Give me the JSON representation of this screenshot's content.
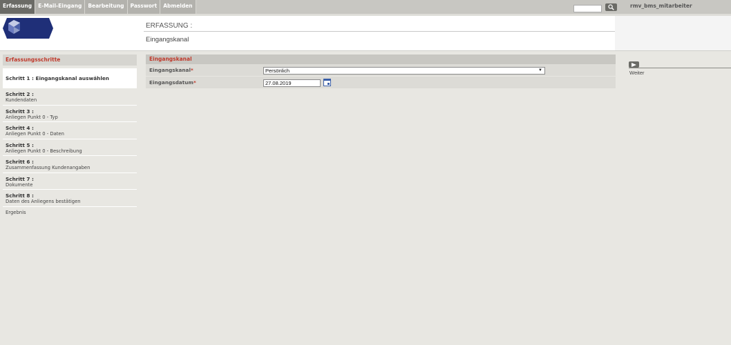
{
  "nav": {
    "tabs": [
      {
        "label": "Erfassung",
        "active": true
      },
      {
        "label": "E-Mail-Eingang",
        "active": false
      },
      {
        "label": "Bearbeitung",
        "active": false
      },
      {
        "label": "Passwort",
        "active": false
      },
      {
        "label": "Abmelden",
        "active": false
      }
    ],
    "search_value": "",
    "user": "rmv_bms_mitarbeiter"
  },
  "header": {
    "title": "ERFASSUNG :",
    "subtitle": "Eingangskanal"
  },
  "sidebar": {
    "heading": "Erfassungsschritte",
    "steps": [
      {
        "title": "Schritt 1 : Eingangskanal auswählen",
        "desc": ""
      },
      {
        "title": "Schritt 2 :",
        "desc": "Kundendaten"
      },
      {
        "title": "Schritt 3 :",
        "desc": "Anliegen Punkt 0 - Typ"
      },
      {
        "title": "Schritt 4 :",
        "desc": "Anliegen Punkt 0 - Daten"
      },
      {
        "title": "Schritt 5 :",
        "desc": "Anliegen Punkt 0 - Beschreibung"
      },
      {
        "title": "Schritt 6 :",
        "desc": "Zusammenfassung Kundenangaben"
      },
      {
        "title": "Schritt 7 :",
        "desc": "Dokumente"
      },
      {
        "title": "Schritt 8 :",
        "desc": "Daten des Anliegens bestätigen"
      }
    ],
    "result": "Ergebnis"
  },
  "form": {
    "heading": "Eingangskanal",
    "channel_label": "Eingangskanal",
    "channel_value": "Persönlich",
    "date_label": "Eingangsdatum",
    "date_value": "27.08.2019",
    "required_mark": "*"
  },
  "actions": {
    "next_label": "Weiter"
  },
  "colors": {
    "accent": "#c0392b",
    "nav_active": "#6b6b66",
    "nav_tab": "#b3b2ad",
    "logo": "#1f2f78"
  }
}
